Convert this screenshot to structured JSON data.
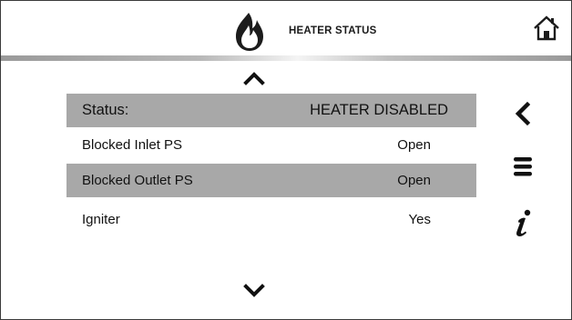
{
  "header": {
    "title": "HEATER STATUS",
    "icons": {
      "left": "flame-icon",
      "right": "home-icon"
    }
  },
  "scroll": {
    "up_icon": "chevron-up-icon",
    "down_icon": "chevron-down-icon"
  },
  "status_rows": [
    {
      "label": "Status:",
      "value": "HEATER DISABLED",
      "shaded": true
    },
    {
      "label": "Blocked Inlet PS",
      "value": "Open",
      "shaded": false
    },
    {
      "label": "Blocked Outlet PS",
      "value": "Open",
      "shaded": true
    },
    {
      "label": "Igniter",
      "value": "Yes",
      "shaded": false
    }
  ],
  "side_nav": {
    "icons": [
      "back-arrow-icon",
      "menu-icon",
      "info-icon"
    ]
  },
  "colors": {
    "row_shade": "#a8a8a8",
    "border": "#3a3a3a",
    "text": "#111111"
  }
}
